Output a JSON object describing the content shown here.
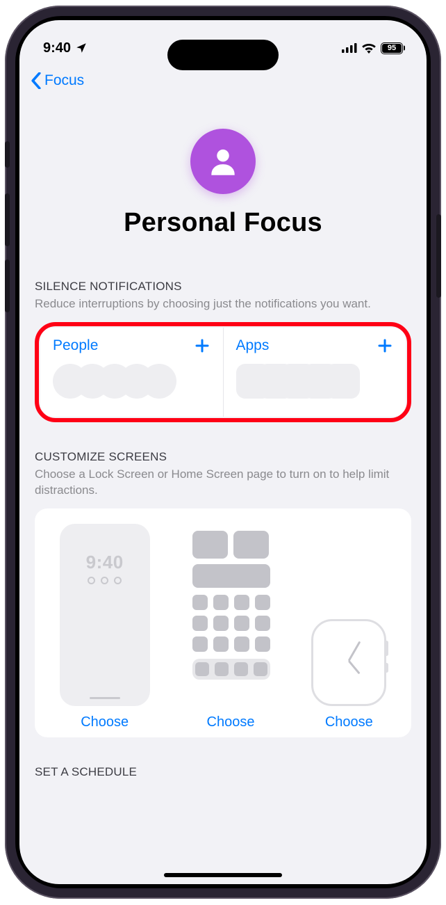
{
  "status": {
    "time": "9:40",
    "battery_pct": "95"
  },
  "nav": {
    "back_label": "Focus"
  },
  "hero": {
    "title": "Personal Focus"
  },
  "silence": {
    "heading": "SILENCE NOTIFICATIONS",
    "subtext": "Reduce interruptions by choosing just the notifications you want.",
    "people_label": "People",
    "apps_label": "Apps"
  },
  "customize": {
    "heading": "CUSTOMIZE SCREENS",
    "subtext": "Choose a Lock Screen or Home Screen page to turn on to help limit distractions.",
    "lock_time": "9:40",
    "choose_label": "Choose"
  },
  "schedule": {
    "heading": "SET A SCHEDULE"
  }
}
